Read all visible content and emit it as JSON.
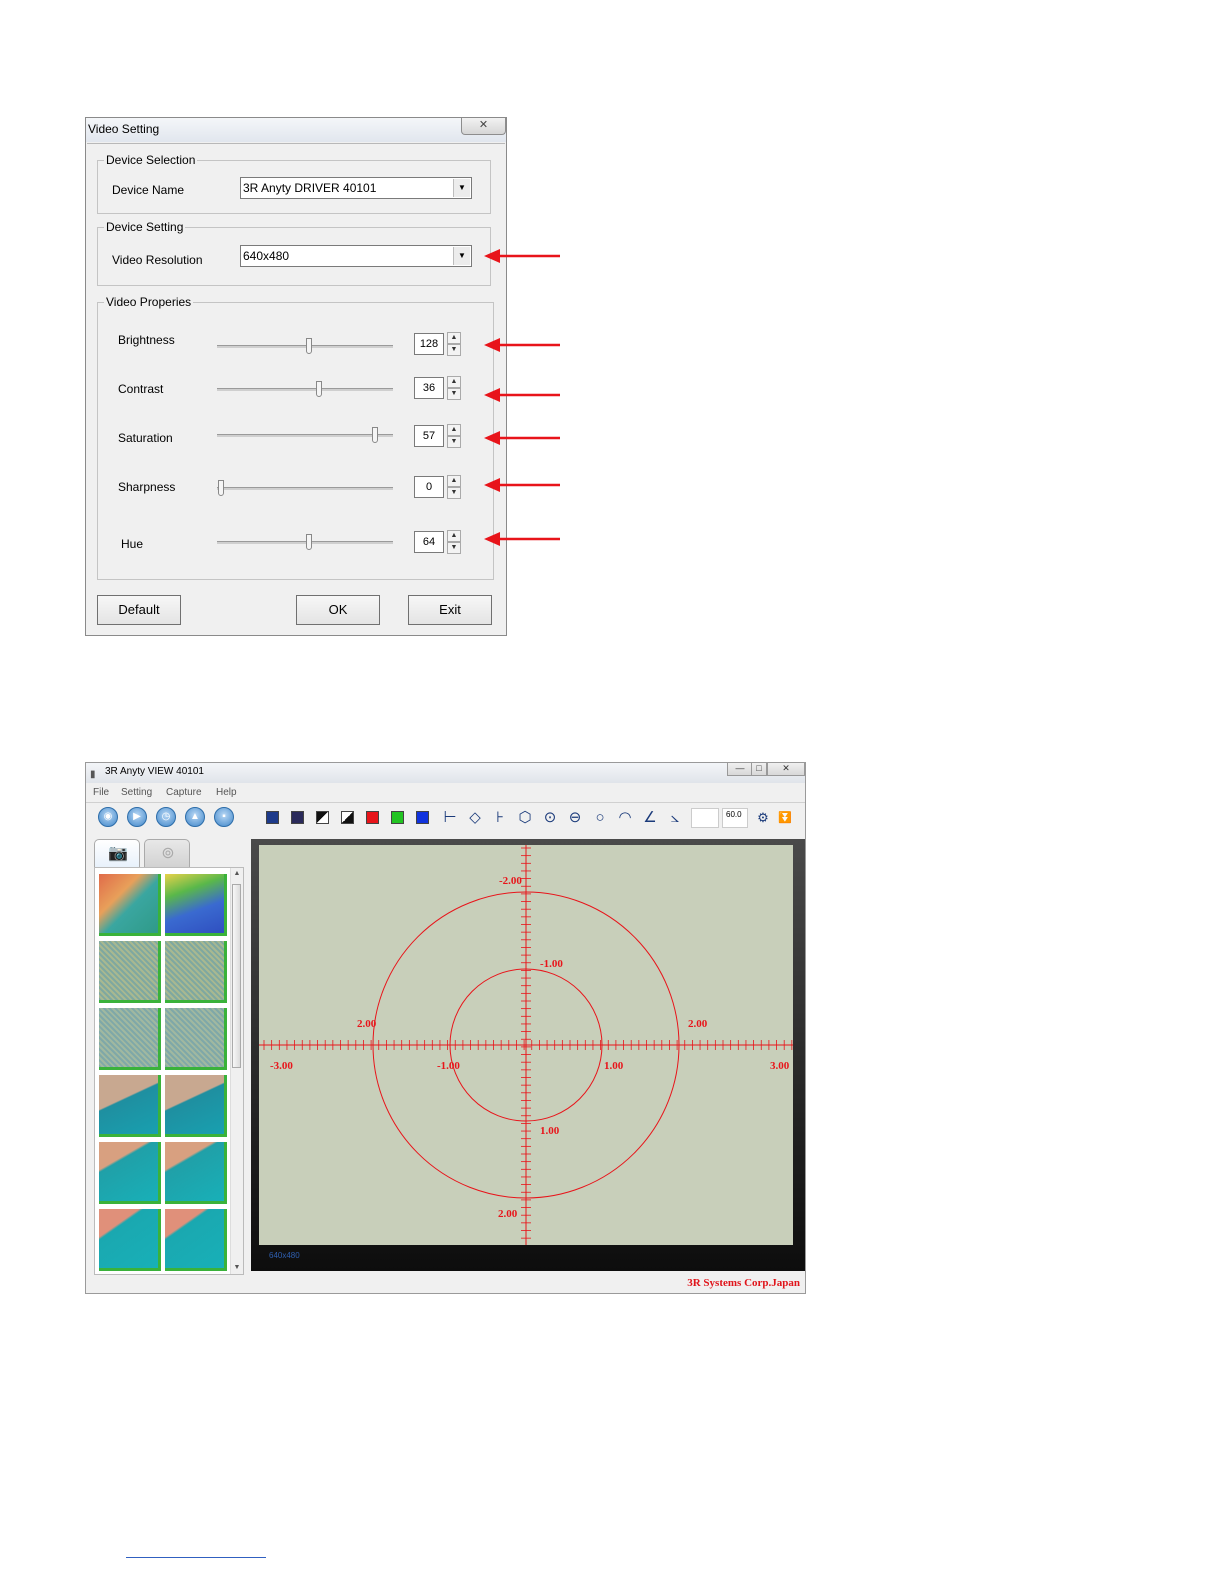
{
  "video_setting": {
    "title": "Video Setting",
    "close_glyph": "✕",
    "device_selection": {
      "group_label": "Device Selection",
      "device_name_label": "Device Name",
      "device_name_value": "3R Anyty DRIVER 40101"
    },
    "device_setting": {
      "group_label": "Device Setting",
      "resolution_label": "Video Resolution",
      "resolution_value": "640x480"
    },
    "video_properties": {
      "group_label": "Video Properies",
      "items": [
        {
          "label": "Brightness",
          "value": "128",
          "slider_fraction": 0.52
        },
        {
          "label": "Contrast",
          "value": "36",
          "slider_fraction": 0.58
        },
        {
          "label": "Saturation",
          "value": "57",
          "slider_fraction": 0.9
        },
        {
          "label": "Sharpness",
          "value": "0",
          "slider_fraction": 0.02
        },
        {
          "label": "Hue",
          "value": "64",
          "slider_fraction": 0.52
        }
      ]
    },
    "buttons": {
      "default": "Default",
      "ok": "OK",
      "exit": "Exit"
    }
  },
  "annotation": {
    "arrow_color": "#e8141a"
  },
  "anyty_view": {
    "title": "3R Anyty VIEW 40101",
    "menu": [
      "File",
      "Setting",
      "Capture",
      "Help"
    ],
    "toolbar": {
      "zoom_value": "60.0",
      "color_swatches": [
        "#e8141a",
        "#22c422",
        "#1133dd"
      ]
    },
    "overlay": {
      "color": "#e8141a",
      "labels": {
        "top": "-2.00",
        "inner_top": "-1.00",
        "left_mid": "2.00",
        "right_mid": "2.00",
        "far_left": "-3.00",
        "inner_left": "-1.00",
        "inner_right": "1.00",
        "far_right": "3.00",
        "inner_bottom": "1.00",
        "bottom": "2.00"
      }
    },
    "resolution_readout": "640x480",
    "company": "3R Systems Corp.Japan"
  }
}
